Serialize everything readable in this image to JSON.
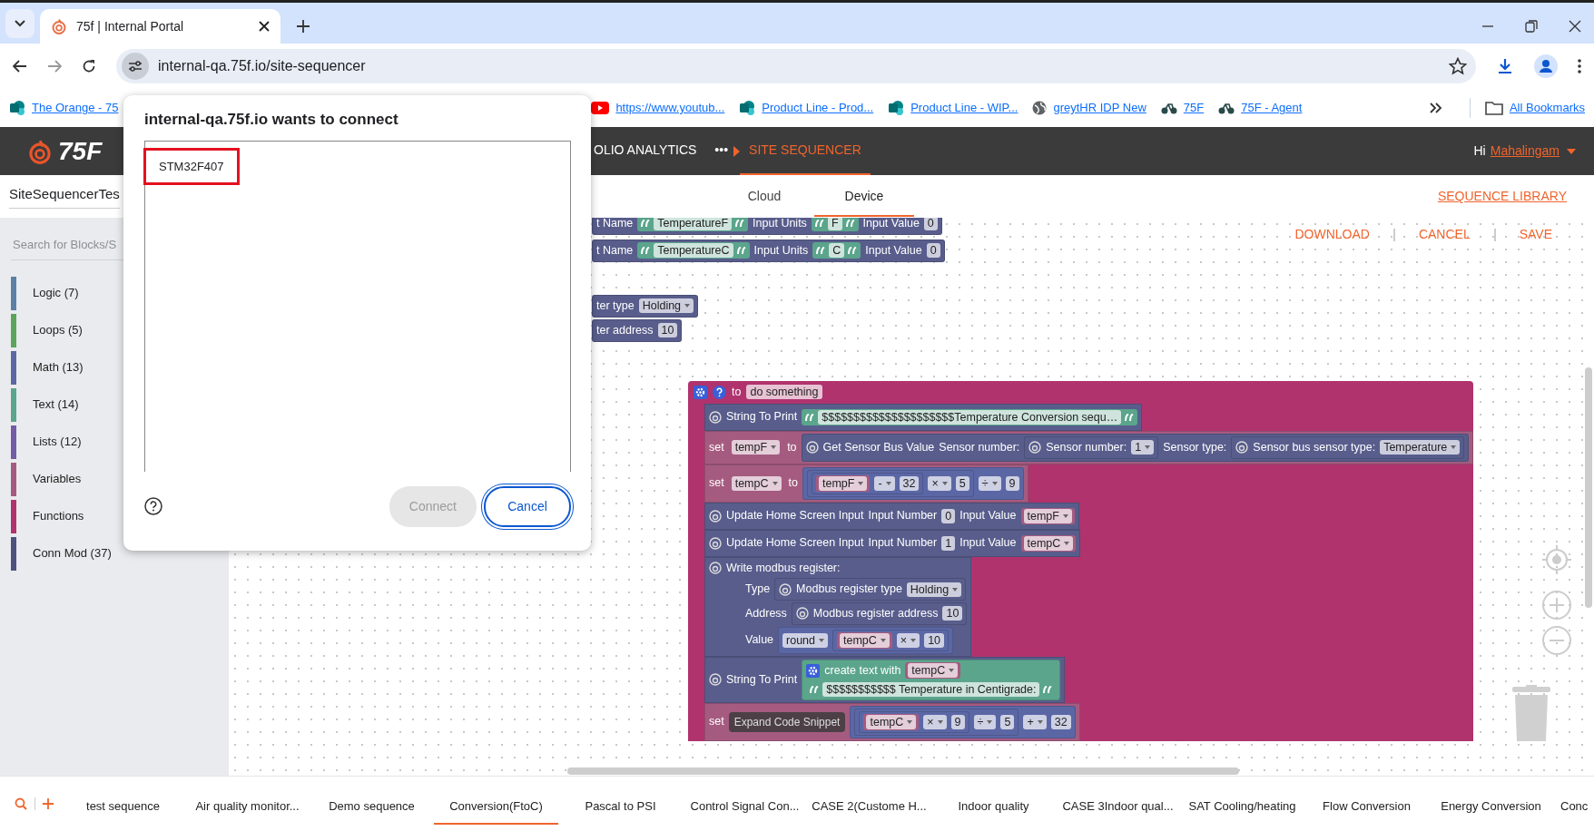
{
  "browser": {
    "tabs": [
      {
        "title": "75f | Internal Portal",
        "selected": true
      }
    ],
    "url": "internal-qa.75f.io/site-sequencer",
    "bookmarks": [
      {
        "label": "The Orange - 75",
        "kind": "sharepoint"
      },
      {
        "label": "https://www.youtub...",
        "kind": "youtube"
      },
      {
        "label": "Product Line - Prod...",
        "kind": "sharepoint"
      },
      {
        "label": "Product Line - WIP...",
        "kind": "sharepoint"
      },
      {
        "label": "greytHR IDP New",
        "kind": "globe"
      },
      {
        "label": "75F",
        "kind": "app"
      },
      {
        "label": "75F - Agent",
        "kind": "app"
      }
    ],
    "all_bookmarks": "All Bookmarks"
  },
  "app": {
    "logo": "75F",
    "nav": [
      {
        "label": "OLIO ANALYTICS",
        "kind": "link",
        "selected": false
      },
      {
        "label": "•••",
        "kind": "more",
        "selected": false
      },
      {
        "label": "SITE SEQUENCER",
        "kind": "link",
        "selected": true
      }
    ],
    "user": {
      "greeting": "Hi",
      "name": "Mahalingam"
    }
  },
  "sequence_name": "SiteSequencerTes",
  "modes": [
    {
      "label": "Cloud",
      "selected": false
    },
    {
      "label": "Device",
      "selected": true
    }
  ],
  "library": "SEQUENCE LIBRARY",
  "actions": [
    "DOWNLOAD",
    "CANCEL",
    "SAVE"
  ],
  "sidebar": {
    "search_placeholder": "Search for Blocks/S",
    "categories": [
      {
        "label": "Logic (7)",
        "color": "#5b80a5"
      },
      {
        "label": "Loops (5)",
        "color": "#5ba55b"
      },
      {
        "label": "Math (13)",
        "color": "#5b67a5"
      },
      {
        "label": "Text (14)",
        "color": "#5ba58c"
      },
      {
        "label": "Lists (12)",
        "color": "#745ba5"
      },
      {
        "label": "Variables",
        "color": "#a55b80"
      },
      {
        "label": "Functions",
        "color": "#b0336d"
      },
      {
        "label": "Conn Mod (37)",
        "color": "#4e5280"
      }
    ]
  },
  "canvas_blocks": [
    {
      "color": "#585d8c",
      "rows": [
        [
          {
            "kind": "label",
            "text": "t Name"
          },
          {
            "kind": "string",
            "text": "TemperatureF"
          },
          {
            "kind": "label",
            "text": "Input Units"
          },
          {
            "kind": "string",
            "text": "F"
          },
          {
            "kind": "label",
            "text": "Input Value"
          },
          {
            "kind": "field",
            "text": "0"
          }
        ]
      ]
    },
    {
      "color": "#585d8c",
      "rows": [
        [
          {
            "kind": "label",
            "text": "t Name"
          },
          {
            "kind": "string",
            "text": "TemperatureC"
          },
          {
            "kind": "label",
            "text": "Input Units"
          },
          {
            "kind": "string",
            "text": "C"
          },
          {
            "kind": "label",
            "text": "Input Value"
          },
          {
            "kind": "field",
            "text": "0"
          }
        ]
      ]
    },
    {
      "color": "#585d8c",
      "rows": [
        [
          {
            "kind": "label",
            "text": "ter type"
          },
          {
            "kind": "dropdown",
            "text": "Holding"
          }
        ]
      ]
    },
    {
      "color": "#585d8c",
      "rows": [
        [
          {
            "kind": "label",
            "text": "ter address"
          },
          {
            "kind": "field",
            "text": "10"
          }
        ]
      ]
    }
  ],
  "function_block": {
    "color": "#b0336d",
    "header": [
      {
        "kind": "gear"
      },
      {
        "kind": "help"
      },
      {
        "kind": "label",
        "text": "to"
      },
      {
        "kind": "field",
        "text": "do something"
      }
    ],
    "statements": [
      {
        "color": "#585d8c",
        "rows": [
          [
            {
              "kind": "sensor"
            },
            {
              "kind": "label",
              "text": "String To Print"
            },
            {
              "kind": "string",
              "text": "$$$$$$$$$$$$$$$$$$$$$Temperature Conversion sequ…"
            }
          ]
        ]
      },
      {
        "color": "#a55b80",
        "rows": [
          [
            {
              "kind": "label",
              "text": "set"
            },
            {
              "kind": "var",
              "text": "tempF"
            },
            {
              "kind": "label",
              "text": "to"
            },
            {
              "kind": "block",
              "color": "#585d8c",
              "rows": [
                [
                  {
                    "kind": "sensor"
                  },
                  {
                    "kind": "label",
                    "text": "Get Sensor Bus Value"
                  },
                  {
                    "kind": "label",
                    "text": "Sensor number:"
                  },
                  {
                    "kind": "block",
                    "color": "#585d8c",
                    "rows": [
                      [
                        {
                          "kind": "sensor"
                        },
                        {
                          "kind": "label",
                          "text": "Sensor number:"
                        },
                        {
                          "kind": "dropdown",
                          "text": "1"
                        }
                      ]
                    ]
                  },
                  {
                    "kind": "label",
                    "text": "Sensor type:"
                  },
                  {
                    "kind": "block",
                    "color": "#585d8c",
                    "rows": [
                      [
                        {
                          "kind": "sensor"
                        },
                        {
                          "kind": "label",
                          "text": "Sensor bus sensor type:"
                        },
                        {
                          "kind": "dropdown",
                          "text": "Temperature"
                        }
                      ]
                    ]
                  }
                ]
              ]
            }
          ]
        ]
      },
      {
        "color": "#a55b80",
        "rows": [
          [
            {
              "kind": "label",
              "text": "set"
            },
            {
              "kind": "var",
              "text": "tempC"
            },
            {
              "kind": "label",
              "text": "to"
            },
            {
              "kind": "block",
              "color": "#5b67a5",
              "rows": [
                [
                  {
                    "kind": "block",
                    "color": "#5b67a5",
                    "rows": [
                      [
                        {
                          "kind": "block",
                          "color": "#5b67a5",
                          "rows": [
                            [
                              {
                                "kind": "var",
                                "text": "tempF"
                              },
                              {
                                "kind": "dropdown",
                                "text": "-"
                              },
                              {
                                "kind": "field",
                                "text": "32"
                              }
                            ]
                          ]
                        },
                        {
                          "kind": "dropdown",
                          "text": "×"
                        },
                        {
                          "kind": "field",
                          "text": "5"
                        }
                      ]
                    ]
                  },
                  {
                    "kind": "dropdown",
                    "text": "÷"
                  },
                  {
                    "kind": "field",
                    "text": "9"
                  }
                ]
              ]
            }
          ]
        ]
      },
      {
        "color": "#585d8c",
        "rows": [
          [
            {
              "kind": "sensor"
            },
            {
              "kind": "label",
              "text": "Update Home Screen Input"
            },
            {
              "kind": "label",
              "text": "Input Number"
            },
            {
              "kind": "field",
              "text": "0"
            },
            {
              "kind": "label",
              "text": "Input Value"
            },
            {
              "kind": "var",
              "text": "tempF"
            }
          ]
        ]
      },
      {
        "color": "#585d8c",
        "rows": [
          [
            {
              "kind": "sensor"
            },
            {
              "kind": "label",
              "text": "Update Home Screen Input"
            },
            {
              "kind": "label",
              "text": "Input Number"
            },
            {
              "kind": "field",
              "text": "1"
            },
            {
              "kind": "label",
              "text": "Input Value"
            },
            {
              "kind": "var",
              "text": "tempC"
            }
          ]
        ]
      },
      {
        "color": "#585d8c",
        "rows": [
          [
            {
              "kind": "sensor"
            },
            {
              "kind": "label",
              "text": "Write modbus register:"
            }
          ],
          [
            {
              "kind": "label",
              "text": "Type"
            },
            {
              "kind": "block",
              "color": "#585d8c",
              "rows": [
                [
                  {
                    "kind": "sensor"
                  },
                  {
                    "kind": "label",
                    "text": "Modbus register type"
                  },
                  {
                    "kind": "dropdown",
                    "text": "Holding"
                  }
                ]
              ]
            }
          ],
          [
            {
              "kind": "label",
              "text": "Address"
            },
            {
              "kind": "block",
              "color": "#585d8c",
              "rows": [
                [
                  {
                    "kind": "sensor"
                  },
                  {
                    "kind": "label",
                    "text": "Modbus register address"
                  },
                  {
                    "kind": "field",
                    "text": "10"
                  }
                ]
              ]
            }
          ],
          [
            {
              "kind": "label",
              "text": "Value"
            },
            {
              "kind": "block",
              "color": "#5b67a5",
              "rows": [
                [
                  {
                    "kind": "dropdown",
                    "text": "round"
                  },
                  {
                    "kind": "block",
                    "color": "#5b67a5",
                    "rows": [
                      [
                        {
                          "kind": "var",
                          "text": "tempC"
                        },
                        {
                          "kind": "dropdown",
                          "text": "×"
                        },
                        {
                          "kind": "field",
                          "text": "10"
                        }
                      ]
                    ]
                  }
                ]
              ]
            }
          ]
        ]
      },
      {
        "color": "#585d8c",
        "rows": [
          [
            {
              "kind": "sensor"
            },
            {
              "kind": "label",
              "text": "String To Print"
            },
            {
              "kind": "block",
              "color": "#5ba58c",
              "rows": [
                [
                  {
                    "kind": "gear"
                  },
                  {
                    "kind": "label",
                    "text": "create text with"
                  },
                  {
                    "kind": "var",
                    "text": "tempC"
                  }
                ],
                [
                  {
                    "kind": "string",
                    "text": "$$$$$$$$$$$ Temperature in Centigrade:"
                  }
                ]
              ]
            }
          ]
        ]
      },
      {
        "color": "#a55b80",
        "rows": [
          [
            {
              "kind": "label",
              "text": "set"
            },
            {
              "kind": "tooltip",
              "text": "Expand Code Snippet"
            },
            {
              "kind": "block",
              "color": "#5b67a5",
              "rows": [
                [
                  {
                    "kind": "block",
                    "color": "#5b67a5",
                    "rows": [
                      [
                        {
                          "kind": "block",
                          "color": "#5b67a5",
                          "rows": [
                            [
                              {
                                "kind": "var",
                                "text": "tempC"
                              },
                              {
                                "kind": "dropdown",
                                "text": "×"
                              },
                              {
                                "kind": "field",
                                "text": "9"
                              }
                            ]
                          ]
                        },
                        {
                          "kind": "dropdown",
                          "text": "÷"
                        },
                        {
                          "kind": "field",
                          "text": "5"
                        }
                      ]
                    ]
                  },
                  {
                    "kind": "dropdown",
                    "text": "+"
                  },
                  {
                    "kind": "field",
                    "text": "32"
                  }
                ]
              ]
            }
          ]
        ]
      }
    ]
  },
  "sequence_tabs": [
    {
      "label": "test sequence",
      "selected": false
    },
    {
      "label": "Air quality monitor...",
      "selected": false
    },
    {
      "label": "Demo sequence",
      "selected": false
    },
    {
      "label": "Conversion(FtoC)",
      "selected": true
    },
    {
      "label": "Pascal to PSI",
      "selected": false
    },
    {
      "label": "Control Signal Con...",
      "selected": false
    },
    {
      "label": "CASE 2(Custome H...",
      "selected": false
    },
    {
      "label": "Indoor quality",
      "selected": false
    },
    {
      "label": "CASE 3Indoor qual...",
      "selected": false
    },
    {
      "label": "SAT Cooling/heating",
      "selected": false
    },
    {
      "label": "Flow Conversion",
      "selected": false
    },
    {
      "label": "Energy Conversion",
      "selected": false
    },
    {
      "label": "Conc",
      "selected": false
    }
  ],
  "dialog": {
    "title": "internal-qa.75f.io wants to connect",
    "devices": [
      {
        "label": "STM32F407",
        "selected": true
      }
    ],
    "buttons": [
      {
        "label": "Connect",
        "kind": "secondary",
        "disabled": true
      },
      {
        "label": "Cancel",
        "kind": "primary",
        "disabled": false
      }
    ]
  }
}
